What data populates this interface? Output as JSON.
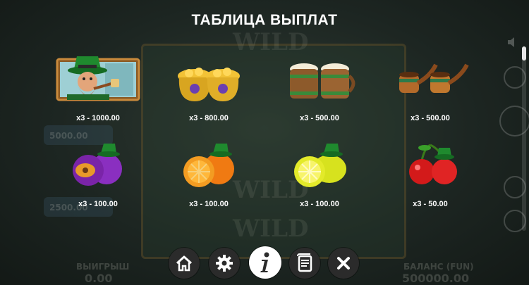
{
  "title": "ТАБЛИЦА ВЫПЛАТ",
  "paytable": [
    {
      "symbol": "leprechaun",
      "payout": "x3 - 1000.00"
    },
    {
      "symbol": "pots-of-gold",
      "payout": "x3 - 800.00"
    },
    {
      "symbol": "beer-mugs",
      "payout": "x3 - 500.00"
    },
    {
      "symbol": "pipes",
      "payout": "x3 - 500.00"
    },
    {
      "symbol": "plum",
      "payout": "x3 - 100.00"
    },
    {
      "symbol": "orange",
      "payout": "x3 - 100.00"
    },
    {
      "symbol": "lemon",
      "payout": "x3 - 100.00"
    },
    {
      "symbol": "cherries",
      "payout": "x3 - 50.00"
    }
  ],
  "toolbar": {
    "home_icon": "home-icon",
    "settings_icon": "gear-icon",
    "info_icon": "info-icon",
    "rules_icon": "scroll-icon",
    "close_icon": "close-icon"
  },
  "background": {
    "reel_text": "WILD",
    "win_label": "ВЫИГРЫШ",
    "win_value": "0.00",
    "balance_label": "БАЛАНС (FUN)",
    "balance_value": "500000.00",
    "jackpot_1": "5000.00",
    "jackpot_2": "2500.00"
  },
  "colors": {
    "active_button": "#ffffff",
    "button": "#2b2b2b",
    "text": "#ffffff"
  }
}
